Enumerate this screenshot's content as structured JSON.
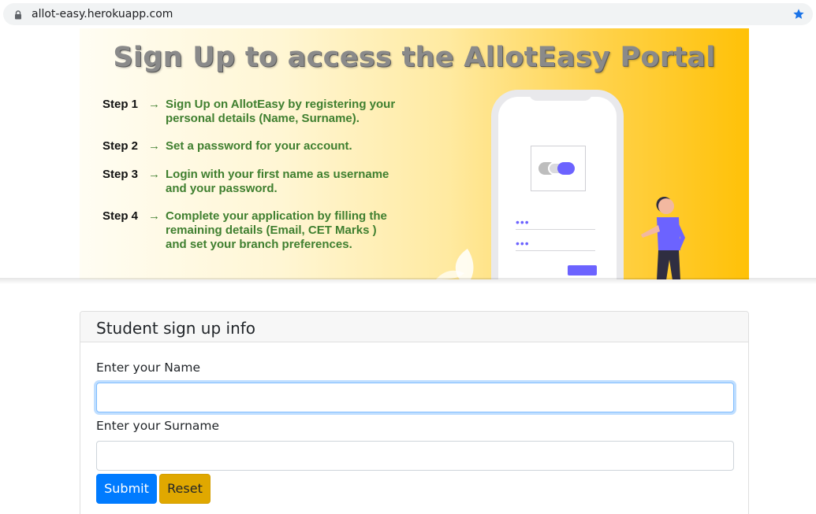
{
  "browser": {
    "url": "allot-easy.herokuapp.com",
    "lock_icon": "lock-icon",
    "bookmark_icon": "star-icon"
  },
  "banner": {
    "title": "Sign Up to access the AllotEasy Portal",
    "arrow": "→",
    "steps": [
      {
        "label": "Step 1",
        "line1": "Sign Up on AllotEasy by registering your",
        "line2": "personal details (Name, Surname).",
        "line3": ""
      },
      {
        "label": "Step 2",
        "line1": "Set a password for your account.",
        "line2": "",
        "line3": ""
      },
      {
        "label": "Step 3",
        "line1": "Login with your first name as username",
        "line2": "and your password.",
        "line3": ""
      },
      {
        "label": "Step 4",
        "line1": "Complete your application by filling the",
        "line2": "remaining details (Email, CET Marks )",
        "line3": "and set your branch preferences."
      }
    ],
    "dots": "•••"
  },
  "form": {
    "header": "Student sign up info",
    "name_label": "Enter your Name",
    "name_value": "",
    "surname_label": "Enter your Surname",
    "surname_value": "",
    "submit_label": "Submit",
    "reset_label": "Reset"
  },
  "colors": {
    "primary": "#007bff",
    "warning": "#e0a800",
    "banner_accent": "#ffc107",
    "step_text": "#3f7f2f",
    "illustration": "#6c63ff"
  }
}
